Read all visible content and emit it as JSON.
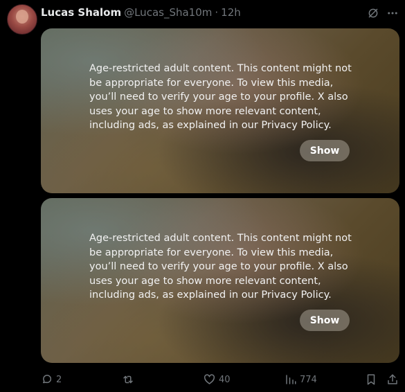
{
  "tweet": {
    "author_name": "Lucas Shalom",
    "author_handle": "@Lucas_Sha10m",
    "separator": "·",
    "time": "12h"
  },
  "media": [
    {
      "notice": "Age-restricted adult content. This content might not be appropriate for everyone. To view this media, you’ll need to verify your age to your profile. X also uses your age to show more relevant content, including ads, as explained in our Privacy Policy.",
      "show_label": "Show"
    },
    {
      "notice": "Age-restricted adult content. This content might not be appropriate for everyone. To view this media, you’ll need to verify your age to your profile. X also uses your age to show more relevant content, including ads, as explained in our Privacy Policy.",
      "show_label": "Show"
    }
  ],
  "actions": {
    "replies": "2",
    "reposts": "",
    "likes": "40",
    "views": "774"
  },
  "icons": {
    "reply": "reply-icon",
    "repost": "repost-icon",
    "like": "heart-icon",
    "views": "views-icon",
    "bookmark": "bookmark-icon",
    "share": "share-icon",
    "grok": "grok-icon"
  },
  "colors": {
    "background": "#000000",
    "text": "#e7e9ea",
    "muted": "#71767b"
  }
}
